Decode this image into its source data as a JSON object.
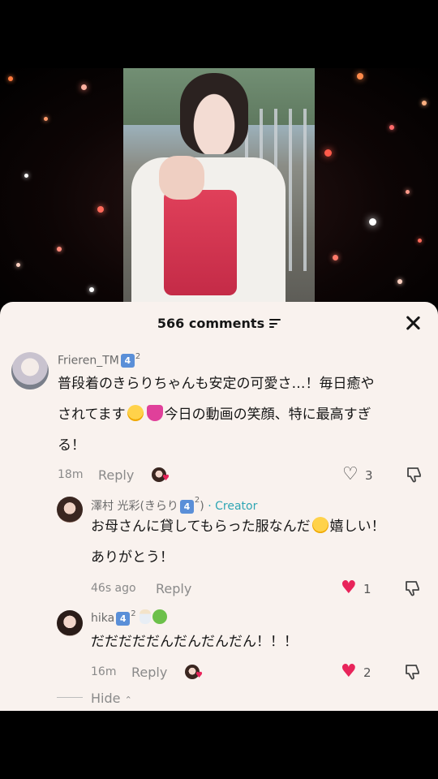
{
  "panel": {
    "comment_count": "566 comments",
    "filter_icon": "filter-icon",
    "close_icon": "close-icon"
  },
  "comments": [
    {
      "username": "Frieren_TM",
      "badge": "4",
      "badge_sup": "2",
      "text_line1": "普段着のきらりちゃんも安定の可愛さ…！毎日癒や",
      "text_line2_a": "されてます",
      "text_line2_b": "今日の動画の笑顔、特に最高すぎ",
      "text_line3": "る！",
      "time": "18m",
      "reply_label": "Reply",
      "likes": "3",
      "liked_by_creator": true
    },
    {
      "username": "澤村 光彩(きらり",
      "badge": "4",
      "badge_sup": "2",
      "username_close": ")",
      "creator_label": "· Creator",
      "text_line1_a": "お母さんに貸してもらった服なんだ",
      "text_line1_b": "嬉しい！",
      "text_line2": "ありがとう！",
      "time": "46s ago",
      "reply_label": "Reply",
      "likes": "1",
      "liked": true
    },
    {
      "username": "hika",
      "badge": "4",
      "badge_sup": "2",
      "text_line1": "だだだだだんだんだんだん！！！",
      "time": "16m",
      "reply_label": "Reply",
      "likes": "2",
      "liked": true,
      "liked_by_creator": true
    }
  ],
  "hide_label": "Hide",
  "colors": {
    "panel_bg": "#f9f2ee",
    "like_red": "#e8245a",
    "creator_teal": "#2fa6b4",
    "badge_blue": "#5a8fd8"
  }
}
